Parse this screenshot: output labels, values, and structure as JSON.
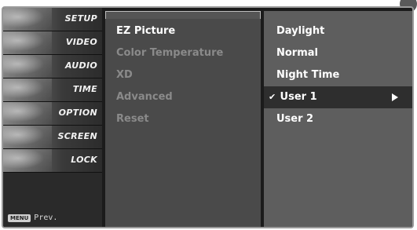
{
  "sidebar": {
    "items": [
      {
        "label": "SETUP"
      },
      {
        "label": "VIDEO"
      },
      {
        "label": "AUDIO"
      },
      {
        "label": "TIME"
      },
      {
        "label": "OPTION"
      },
      {
        "label": "SCREEN"
      },
      {
        "label": "LOCK"
      }
    ],
    "footer": {
      "key_label": "MENU",
      "action_label": "Prev."
    }
  },
  "submenu": {
    "items": [
      {
        "label": "EZ Picture",
        "state": "active"
      },
      {
        "label": "Color Temperature",
        "state": "dim"
      },
      {
        "label": "XD",
        "state": "dim"
      },
      {
        "label": "Advanced",
        "state": "dim"
      },
      {
        "label": "Reset",
        "state": "dim"
      }
    ]
  },
  "options": {
    "items": [
      {
        "label": "Daylight"
      },
      {
        "label": "Normal"
      },
      {
        "label": "Night Time"
      },
      {
        "label": "User 1",
        "check": "✔",
        "selected": true
      },
      {
        "label": "User 2"
      }
    ]
  },
  "icons": {
    "check": "check-icon",
    "submenu_arrow": "triangle-right-icon"
  }
}
